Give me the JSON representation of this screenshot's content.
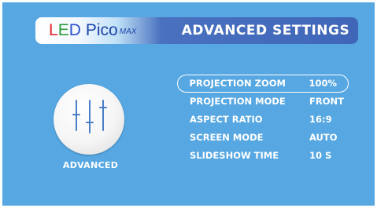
{
  "header": {
    "logo": {
      "led_l": "L",
      "led_e": "E",
      "led_d": "D",
      "pico": "Pico",
      "max": "MAX"
    },
    "title": "ADVANCED SETTINGS"
  },
  "category": {
    "icon": "sliders-icon",
    "label": "ADVANCED"
  },
  "menu": {
    "selected_index": 0,
    "items": [
      {
        "label": "PROJECTION ZOOM",
        "value": "100%"
      },
      {
        "label": "PROJECTION MODE",
        "value": "FRONT"
      },
      {
        "label": "ASPECT RATIO",
        "value": "16:9"
      },
      {
        "label": "SCREEN MODE",
        "value": "AUTO"
      },
      {
        "label": "SLIDESHOW TIME",
        "value": "10 S"
      }
    ]
  },
  "colors": {
    "background": "#56a7e2",
    "header_bar": "#4f78c4",
    "text": "#ffffff",
    "icon_lines": "#4a7fc7"
  }
}
